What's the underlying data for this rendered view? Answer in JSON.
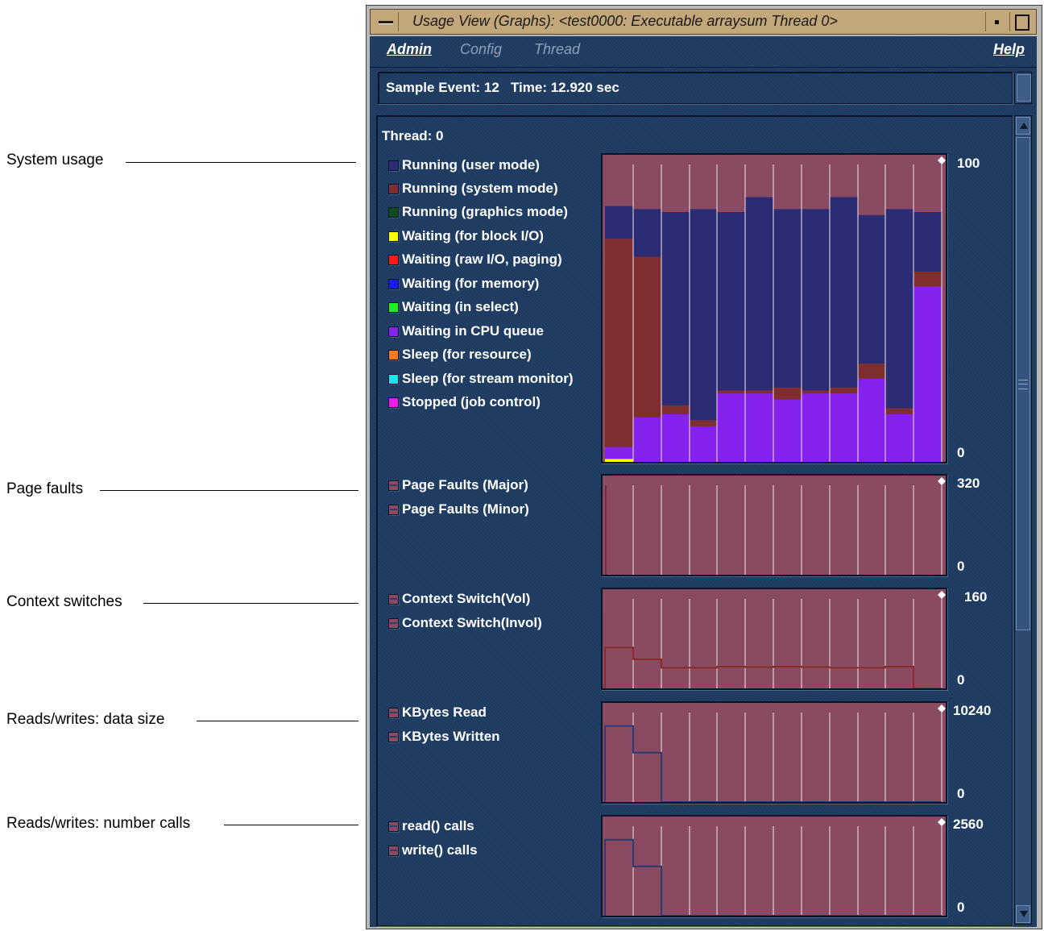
{
  "callouts": [
    {
      "label": "System usage"
    },
    {
      "label": "Page faults"
    },
    {
      "label": "Context switches"
    },
    {
      "label": "Reads/writes: data size"
    },
    {
      "label": "Reads/writes: number calls"
    }
  ],
  "window": {
    "title": "Usage View (Graphs): <test0000: Executable arraysum Thread 0>",
    "menus": [
      "Admin",
      "Config",
      "Thread",
      "Help"
    ],
    "sample_event": "Sample Event: 12   Time: 12.920 sec",
    "thread": "Thread: 0"
  },
  "colors": {
    "background": "#1d3a60",
    "graph_fill": "#8a4a62",
    "user_mode": "#2c2c74",
    "system_mode": "#7e2e2e",
    "cpu_queue": "#8522ee",
    "block_io": "#ffff00",
    "vol_switch_line": "#2a3c70",
    "invol_switch_line": "#8a2a2a"
  },
  "chart_data": [
    {
      "type": "area",
      "name": "System usage",
      "ylim": [
        0,
        100
      ],
      "axis_labels": {
        "max": "100",
        "min": "0"
      },
      "legend": [
        {
          "label": "Running (user mode)",
          "color": "#2c2c74"
        },
        {
          "label": "Running (system mode)",
          "color": "#7e2e2e"
        },
        {
          "label": "Running (graphics mode)",
          "color": "#0f4a20"
        },
        {
          "label": "Waiting (for block I/O)",
          "color": "#ffff00"
        },
        {
          "label": "Waiting (raw I/O, paging)",
          "color": "#ff1a1a"
        },
        {
          "label": "Waiting (for memory)",
          "color": "#1a1aff"
        },
        {
          "label": "Waiting (in select)",
          "color": "#22ee22"
        },
        {
          "label": "Waiting in CPU queue",
          "color": "#8522ee"
        },
        {
          "label": "Sleep (for resource)",
          "color": "#ff7a1a"
        },
        {
          "label": "Sleep (for stream monitor)",
          "color": "#1ae6ee"
        },
        {
          "label": "Stopped (job control)",
          "color": "#ee1aee"
        }
      ],
      "intervals": 12,
      "series": [
        {
          "name": "Waiting (for block I/O)",
          "values": [
            1,
            0,
            0,
            0,
            0,
            0,
            0,
            0,
            0,
            0,
            0,
            0
          ]
        },
        {
          "name": "Waiting in CPU queue",
          "values": [
            4,
            15,
            16,
            12,
            23,
            23,
            21,
            23,
            23,
            28,
            16,
            59
          ]
        },
        {
          "name": "Running (system mode)",
          "values": [
            70,
            54,
            3,
            2,
            1,
            1,
            4,
            1,
            2,
            5,
            2,
            5
          ]
        },
        {
          "name": "Running (user mode)",
          "values": [
            11,
            16,
            65,
            71,
            60,
            65,
            60,
            61,
            64,
            50,
            67,
            20
          ]
        }
      ]
    },
    {
      "type": "bar",
      "name": "Page faults",
      "ylim": [
        0,
        320
      ],
      "axis_labels": {
        "max": "320",
        "min": "0"
      },
      "legend": [
        "Page Faults (Major)",
        "Page Faults (Minor)"
      ],
      "series": [
        {
          "name": "Page Faults (Minor)",
          "values": [
            320,
            0,
            0,
            0,
            0,
            0,
            0,
            0,
            0,
            0,
            0,
            0
          ]
        }
      ]
    },
    {
      "type": "line",
      "name": "Context switches",
      "ylim": [
        0,
        160
      ],
      "axis_labels": {
        "max": "160",
        "min": "0"
      },
      "legend": [
        "Context Switch(Vol)",
        "Context Switch(Invol)"
      ],
      "series": [
        {
          "name": "Context Switch(Invol)",
          "values": [
            73,
            52,
            37,
            37,
            39,
            38,
            39,
            38,
            37,
            37,
            39,
            0
          ]
        }
      ]
    },
    {
      "type": "line",
      "name": "Reads/writes: data size",
      "ylim": [
        0,
        10240
      ],
      "axis_labels": {
        "max": "10240",
        "min": "0"
      },
      "legend": [
        "KBytes Read",
        "KBytes Written"
      ],
      "series": [
        {
          "name": "KBytes Read",
          "values": [
            8700,
            5650,
            0,
            0,
            0,
            0,
            0,
            0,
            0,
            0,
            0,
            0
          ]
        }
      ]
    },
    {
      "type": "line",
      "name": "Reads/writes: number calls",
      "ylim": [
        0,
        2560
      ],
      "axis_labels": {
        "max": "2560",
        "min": "0"
      },
      "legend": [
        "read() calls",
        "write() calls"
      ],
      "series": [
        {
          "name": "read() calls",
          "values": [
            2175,
            1410,
            0,
            0,
            0,
            0,
            0,
            0,
            0,
            0,
            0,
            0
          ]
        }
      ]
    }
  ]
}
